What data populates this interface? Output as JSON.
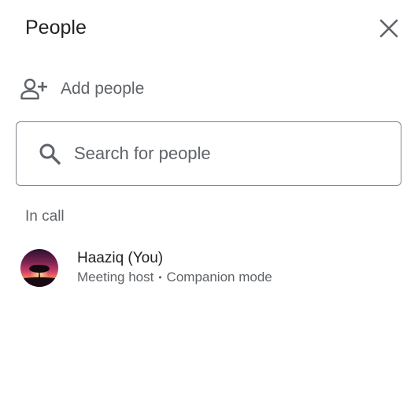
{
  "header": {
    "title": "People",
    "close_icon": "close-icon"
  },
  "add_people": {
    "label": "Add people",
    "icon": "person-add-icon"
  },
  "search": {
    "placeholder": "Search for people",
    "value": "",
    "icon": "search-icon"
  },
  "in_call": {
    "section_label": "In call",
    "participants": [
      {
        "name": "Haaziq (You)",
        "role": "Meeting host",
        "separator": "•",
        "mode": "Companion mode",
        "avatar": "avatar-sunset-tree"
      }
    ]
  },
  "colors": {
    "text_primary": "#202124",
    "text_secondary": "#5f6368",
    "border": "#80868b"
  }
}
